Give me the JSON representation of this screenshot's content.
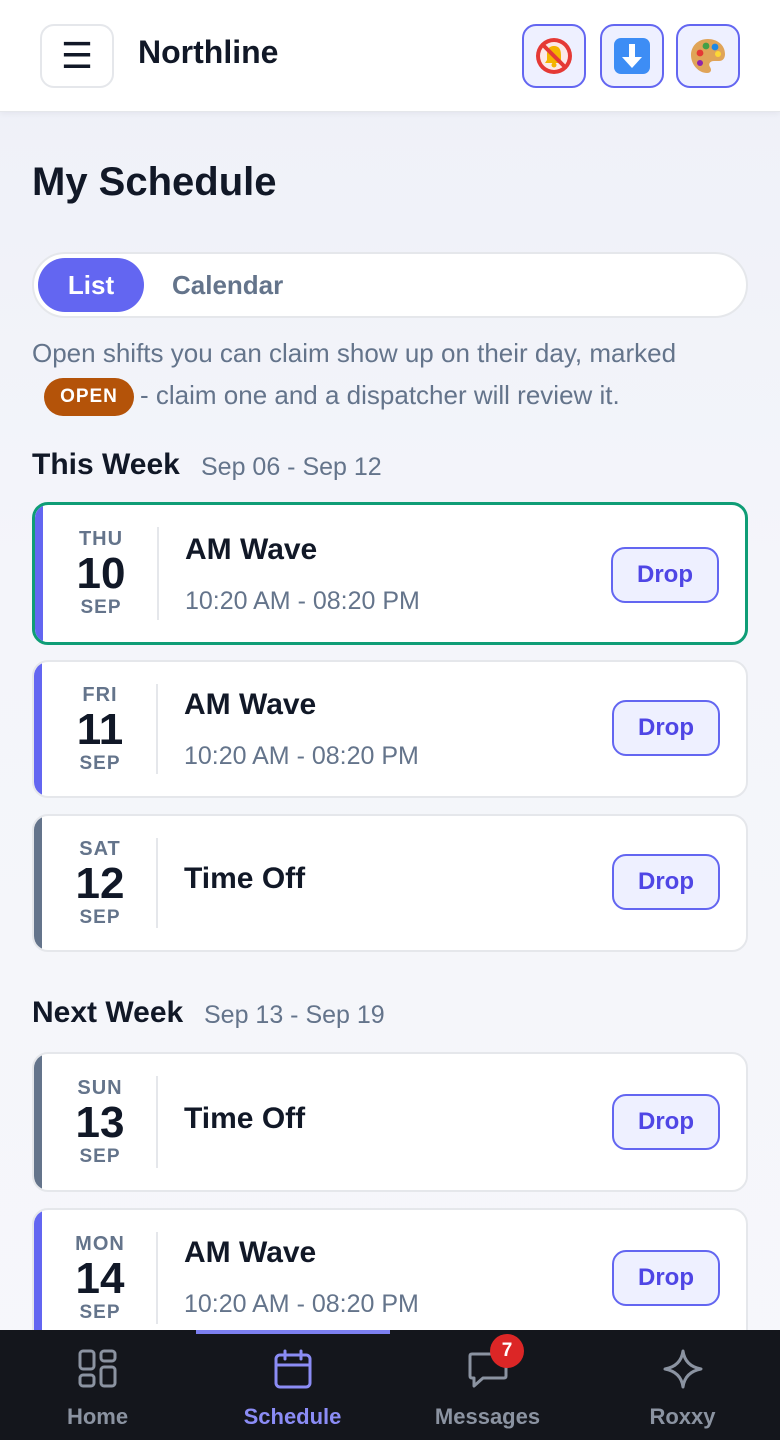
{
  "header": {
    "menu_glyph": "☰",
    "brand": "Northline",
    "icons": [
      "bell-muted-icon",
      "download-icon",
      "palette-icon"
    ]
  },
  "page": {
    "title": "My Schedule",
    "view_toggle": {
      "list": "List",
      "calendar": "Calendar",
      "selected": "List"
    },
    "hint_part1": "Open shifts you can claim show up on their day, marked",
    "open_badge": "OPEN",
    "hint_part2": "- claim one and a dispatcher will review it."
  },
  "sections": [
    {
      "title": "This Week",
      "range": "Sep 06 - Sep 12",
      "shifts": [
        {
          "dow": "THU",
          "day": "10",
          "month": "SEP",
          "name": "AM Wave",
          "time": "10:20 AM - 08:20 PM",
          "action": "Drop",
          "highlighted": true
        },
        {
          "dow": "FRI",
          "day": "11",
          "month": "SEP",
          "name": "AM Wave",
          "time": "10:20 AM - 08:20 PM",
          "action": "Drop"
        },
        {
          "dow": "SAT",
          "day": "12",
          "month": "SEP",
          "name": "Time Off",
          "time": "",
          "action": "Drop"
        }
      ]
    },
    {
      "title": "Next Week",
      "range": "Sep 13 - Sep 19",
      "shifts": [
        {
          "dow": "SUN",
          "day": "13",
          "month": "SEP",
          "name": "Time Off",
          "time": "",
          "action": "Drop"
        },
        {
          "dow": "MON",
          "day": "14",
          "month": "SEP",
          "name": "AM Wave",
          "time": "10:20 AM - 08:20 PM",
          "action": "Drop"
        }
      ]
    }
  ],
  "bottom_nav": {
    "items": [
      {
        "label": "Home",
        "icon": "grid-icon"
      },
      {
        "label": "Schedule",
        "icon": "calendar-icon",
        "active": true
      },
      {
        "label": "Messages",
        "icon": "chat-icon",
        "badge": "7"
      },
      {
        "label": "Roxxy",
        "icon": "sparkle-icon"
      }
    ]
  },
  "colors": {
    "accent": "#6366f1",
    "shift_accent": "#6366f1",
    "timeoff_accent": "#64748b",
    "highlight_border": "#0f9d76",
    "open_badge": "#b45309",
    "badge": "#dc2626"
  }
}
